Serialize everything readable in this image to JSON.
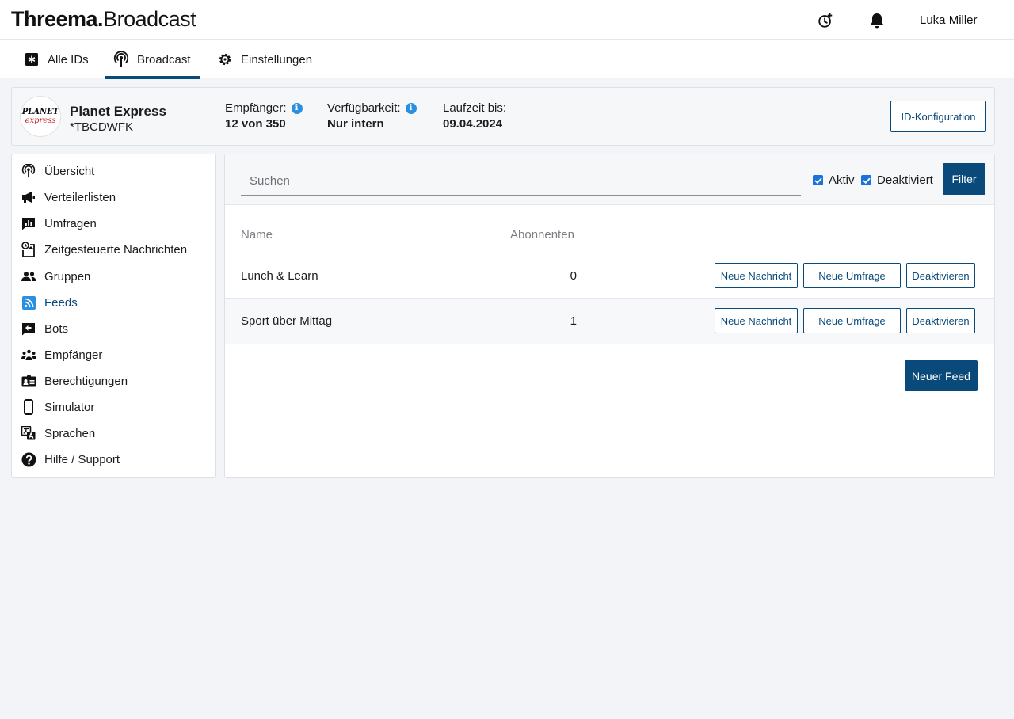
{
  "app": {
    "brand_bold": "Threema.",
    "brand_light": "Broadcast",
    "user_name": "Luka Miller"
  },
  "topbar": {
    "icons": [
      "timer-plus-icon",
      "bell-icon"
    ]
  },
  "tabs": [
    {
      "label": "Alle IDs",
      "icon": "asterisk-box-icon",
      "active": false
    },
    {
      "label": "Broadcast",
      "icon": "broadcast-icon",
      "active": true
    },
    {
      "label": "Einstellungen",
      "icon": "gear-icon",
      "active": false
    }
  ],
  "id_card": {
    "logo_line1": "PLANET",
    "logo_line2": "express",
    "name": "Planet Express",
    "code": "*TBCDWFK",
    "recipients_label": "Empfänger:",
    "recipients_value": "12 von 350",
    "availability_label": "Verfügbarkeit:",
    "availability_value": "Nur intern",
    "runtime_label": "Laufzeit bis:",
    "runtime_value": "09.04.2024",
    "config_button": "ID-Konfiguration"
  },
  "sidebar": {
    "items": [
      {
        "label": "Übersicht",
        "icon": "broadcast-icon",
        "active": false
      },
      {
        "label": "Verteilerlisten",
        "icon": "megaphone-icon",
        "active": false
      },
      {
        "label": "Umfragen",
        "icon": "poll-icon",
        "active": false
      },
      {
        "label": "Zeitgesteuerte Nachrichten",
        "icon": "scheduled-message-icon",
        "active": false
      },
      {
        "label": "Gruppen",
        "icon": "group-icon",
        "active": false
      },
      {
        "label": "Feeds",
        "icon": "rss-icon",
        "active": true
      },
      {
        "label": "Bots",
        "icon": "bot-reply-icon",
        "active": false
      },
      {
        "label": "Empfänger",
        "icon": "recipients-icon",
        "active": false
      },
      {
        "label": "Berechtigungen",
        "icon": "id-card-icon",
        "active": false
      },
      {
        "label": "Simulator",
        "icon": "phone-icon",
        "active": false
      },
      {
        "label": "Sprachen",
        "icon": "translate-icon",
        "active": false
      },
      {
        "label": "Hilfe / Support",
        "icon": "help-icon",
        "active": false
      }
    ]
  },
  "main": {
    "search_placeholder": "Suchen",
    "filter_active_label": "Aktiv",
    "filter_active_checked": true,
    "filter_deactivated_label": "Deaktiviert",
    "filter_deactivated_checked": true,
    "filter_button": "Filter",
    "columns": {
      "name": "Name",
      "subscribers": "Abonnenten"
    },
    "rows": [
      {
        "name": "Lunch & Learn",
        "subscribers": "0",
        "btn_message": "Neue Nachricht",
        "btn_poll": "Neue Umfrage",
        "btn_deactivate": "Deaktivieren"
      },
      {
        "name": "Sport über Mittag",
        "subscribers": "1",
        "btn_message": "Neue Nachricht",
        "btn_poll": "Neue Umfrage",
        "btn_deactivate": "Deaktivieren"
      }
    ],
    "new_feed_button": "Neuer Feed"
  },
  "colors": {
    "primary": "#0a4a7a",
    "info": "#2b8fe0",
    "checkbox": "#1a73d9",
    "background": "#f2f4f8"
  }
}
